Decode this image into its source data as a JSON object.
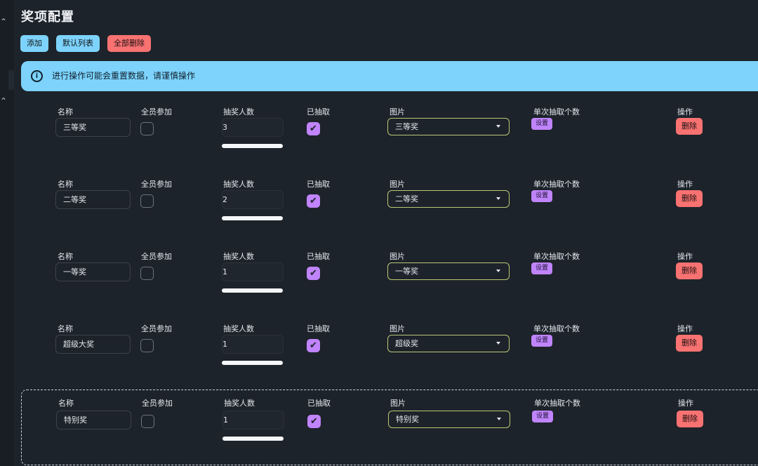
{
  "page": {
    "title": "奖项配置"
  },
  "toolbar": {
    "add_label": "添加",
    "default_list_label": "默认列表",
    "delete_all_label": "全部删除"
  },
  "alert": {
    "message": "进行操作可能会重置数据，请谨慎操作"
  },
  "columns": {
    "name": "名称",
    "all_join": "全员参加",
    "draw_count": "抽奖人数",
    "drawn": "已抽取",
    "image": "图片",
    "per_draw": "单次抽取个数",
    "actions": "操作"
  },
  "row_buttons": {
    "set_label": "设置",
    "delete_label": "删除"
  },
  "prizes": [
    {
      "name": "三等奖",
      "count": "3",
      "all_join": false,
      "drawn": true,
      "image": "三等奖"
    },
    {
      "name": "二等奖",
      "count": "2",
      "all_join": false,
      "drawn": true,
      "image": "二等奖"
    },
    {
      "name": "一等奖",
      "count": "1",
      "all_join": false,
      "drawn": true,
      "image": "一等奖"
    },
    {
      "name": "超级大奖",
      "count": "1",
      "all_join": false,
      "drawn": true,
      "image": "超级奖"
    },
    {
      "name": "特别奖",
      "count": "1",
      "all_join": false,
      "drawn": true,
      "image": "特别奖"
    }
  ],
  "icons": {
    "info": "info-icon",
    "check": "check-icon",
    "dropdown": "chevron-down-icon"
  },
  "colors": {
    "background": "#1d232a",
    "info": "#7dd3fc",
    "error": "#f87272",
    "accent": "#c084fc",
    "select_border": "#b9c878"
  }
}
